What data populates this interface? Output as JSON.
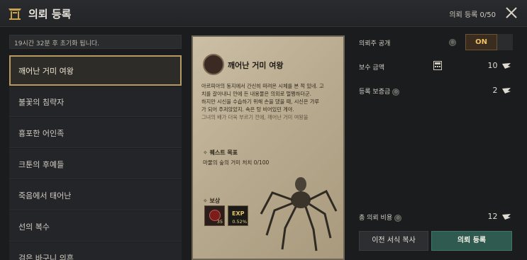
{
  "header": {
    "title": "의뢰 등록",
    "count": "의뢰 등록 0/50"
  },
  "reset_note": "19시간 32분 후 초기화 됩니다.",
  "list": [
    {
      "label": "깨어난 거미 여왕",
      "active": true
    },
    {
      "label": "불꽃의 침략자"
    },
    {
      "label": "흉포한 어인족"
    },
    {
      "label": "크툰의 후예들"
    },
    {
      "label": "죽음에서 태어난"
    },
    {
      "label": "선의 복수"
    },
    {
      "label": "검은 바구니 의흔"
    }
  ],
  "paper": {
    "title": "깨어난 거미 여왕",
    "lines": [
      "아르피아의 동지에서 간신히 떠려온 시체를 본 적 있네. 고",
      "치를 갈아내니 안에 든 내용물은 의외로 멀쩡하더군.",
      "하지만 시신을 수습하기 위해 손을 댔을 때, 시신은 가루",
      "가 되어 주저앉았지. 속은 텅 비어있던 게야.",
      "그녀의 배가 더욱 부르기 전에, 깨어난 거미 여왕을"
    ],
    "quest_head": "퀘스트 목표",
    "quest_text": "마물의 숲의 거미 처치 0/100",
    "reward_head": "보상",
    "reward1_qty": "35",
    "reward2_label": "EXP",
    "reward2_pct": "0.52%"
  },
  "right": {
    "public_label": "의뢰주 공개",
    "toggle_label": "ON",
    "reward_amount_label": "보수 금액",
    "reward_amount_value": "10",
    "deposit_label": "등록 보증금",
    "deposit_value": "2",
    "total_label": "총 의뢰 비용",
    "total_value": "12",
    "copy_button": "이전 서식 복사",
    "register_button": "의뢰 등록"
  }
}
